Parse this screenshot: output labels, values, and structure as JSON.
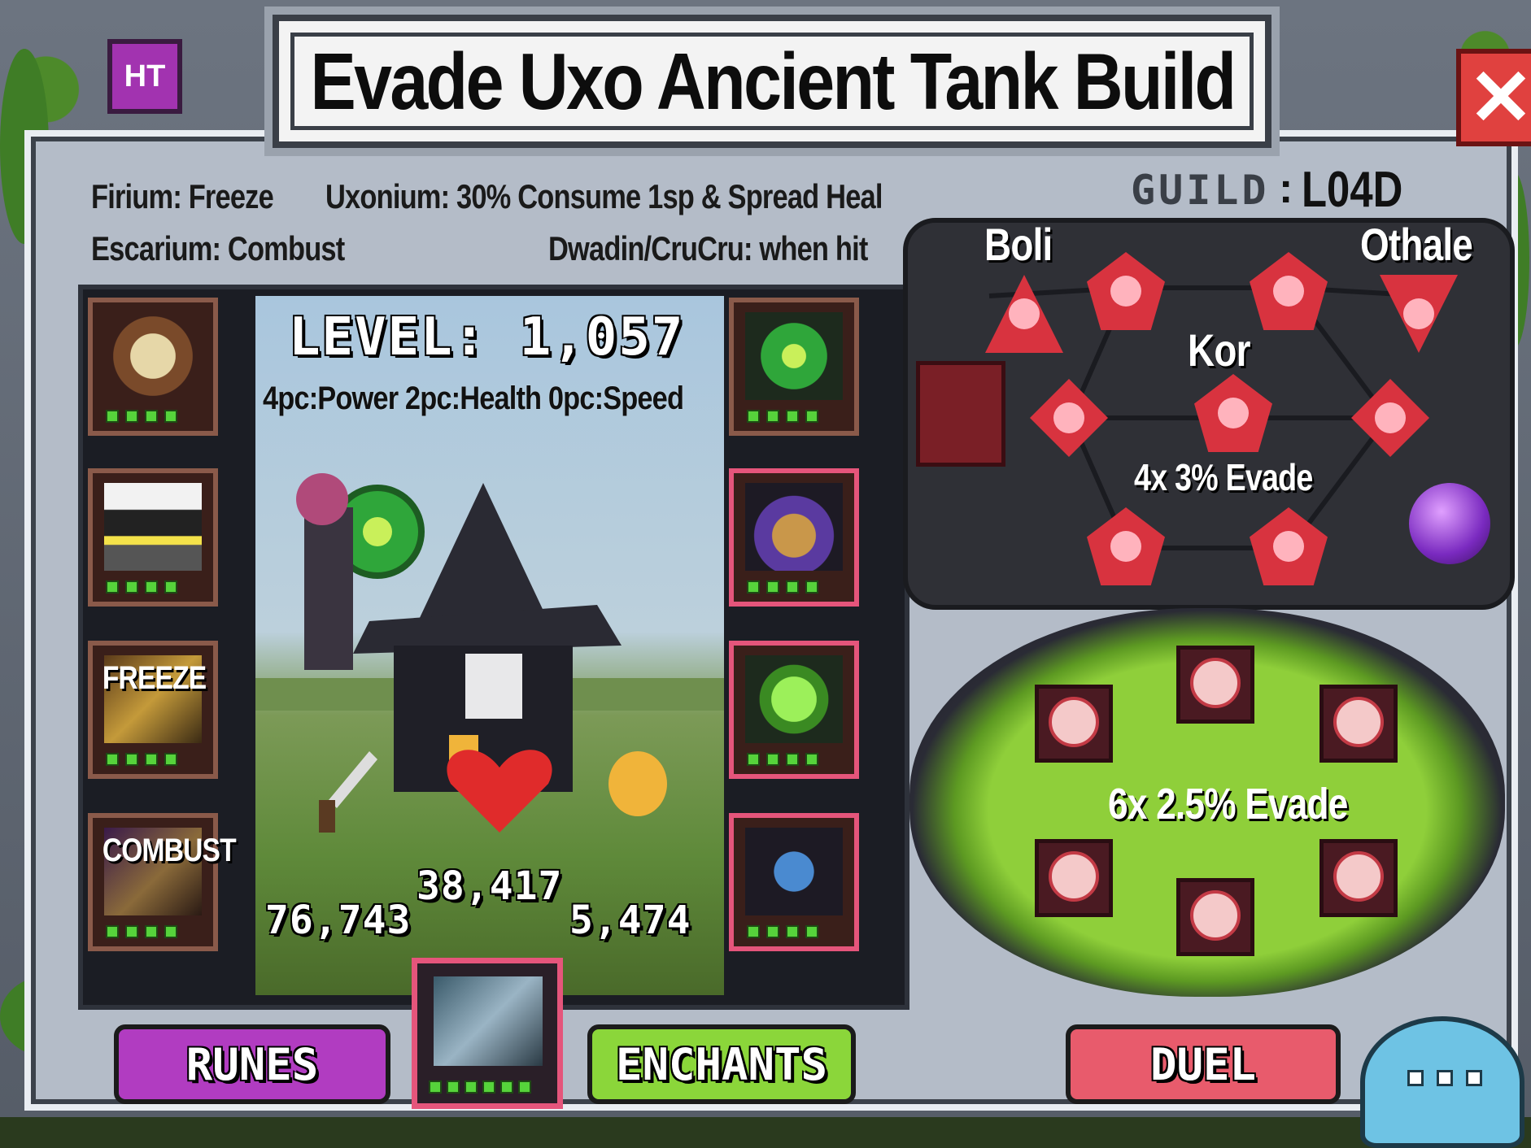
{
  "header": {
    "badge": "HT",
    "title": "Evade Uxo Ancient Tank Build",
    "close_glyph": "✕"
  },
  "info": {
    "firium": "Firium: Freeze",
    "uxonium": "Uxonium: 30% Consume 1sp & Spread Heal",
    "escarium": "Escarium: Combust",
    "dwadin": "Dwadin/CruCru: when hit"
  },
  "guild": {
    "label": "GUILD",
    "separator": ":",
    "value": "L04D"
  },
  "character": {
    "level": "LEVEL: 1,057",
    "set_bonus": "4pc:Power  2pc:Health  0pc:Speed",
    "stats": {
      "attack": "76,743",
      "health": "38,417",
      "speed": "5,474"
    },
    "left_slots": [
      {
        "icon": "skull-amulet-icon",
        "label": ""
      },
      {
        "icon": "armor-icon",
        "label": ""
      },
      {
        "icon": "dragon-head-icon",
        "label": "FREEZE"
      },
      {
        "icon": "beast-head-icon",
        "label": "COMBUST"
      }
    ],
    "right_slots": [
      {
        "icon": "green-orb-icon"
      },
      {
        "icon": "hooded-face-icon"
      },
      {
        "icon": "green-ring-icon"
      },
      {
        "icon": "knight-icon"
      }
    ],
    "pet_icon": "cannon-icon"
  },
  "rune_board": {
    "labels": {
      "left": "Boli",
      "right": "Othale",
      "center": "Kor",
      "bonus": "4x 3% Evade"
    }
  },
  "cauldron": {
    "bonus": "6x 2.5% Evade"
  },
  "buttons": {
    "runes": "RUNES",
    "enchants": "ENCHANTS",
    "duel": "DUEL"
  },
  "colors": {
    "runes_button": "#b13cc1",
    "enchants_button": "#8bd63a",
    "duel_button": "#e85b6c",
    "close_button": "#e0413f",
    "badge": "#a233b0",
    "rune_gem": "#d8333f",
    "cauldron_liquid": "#8fcf3a"
  }
}
